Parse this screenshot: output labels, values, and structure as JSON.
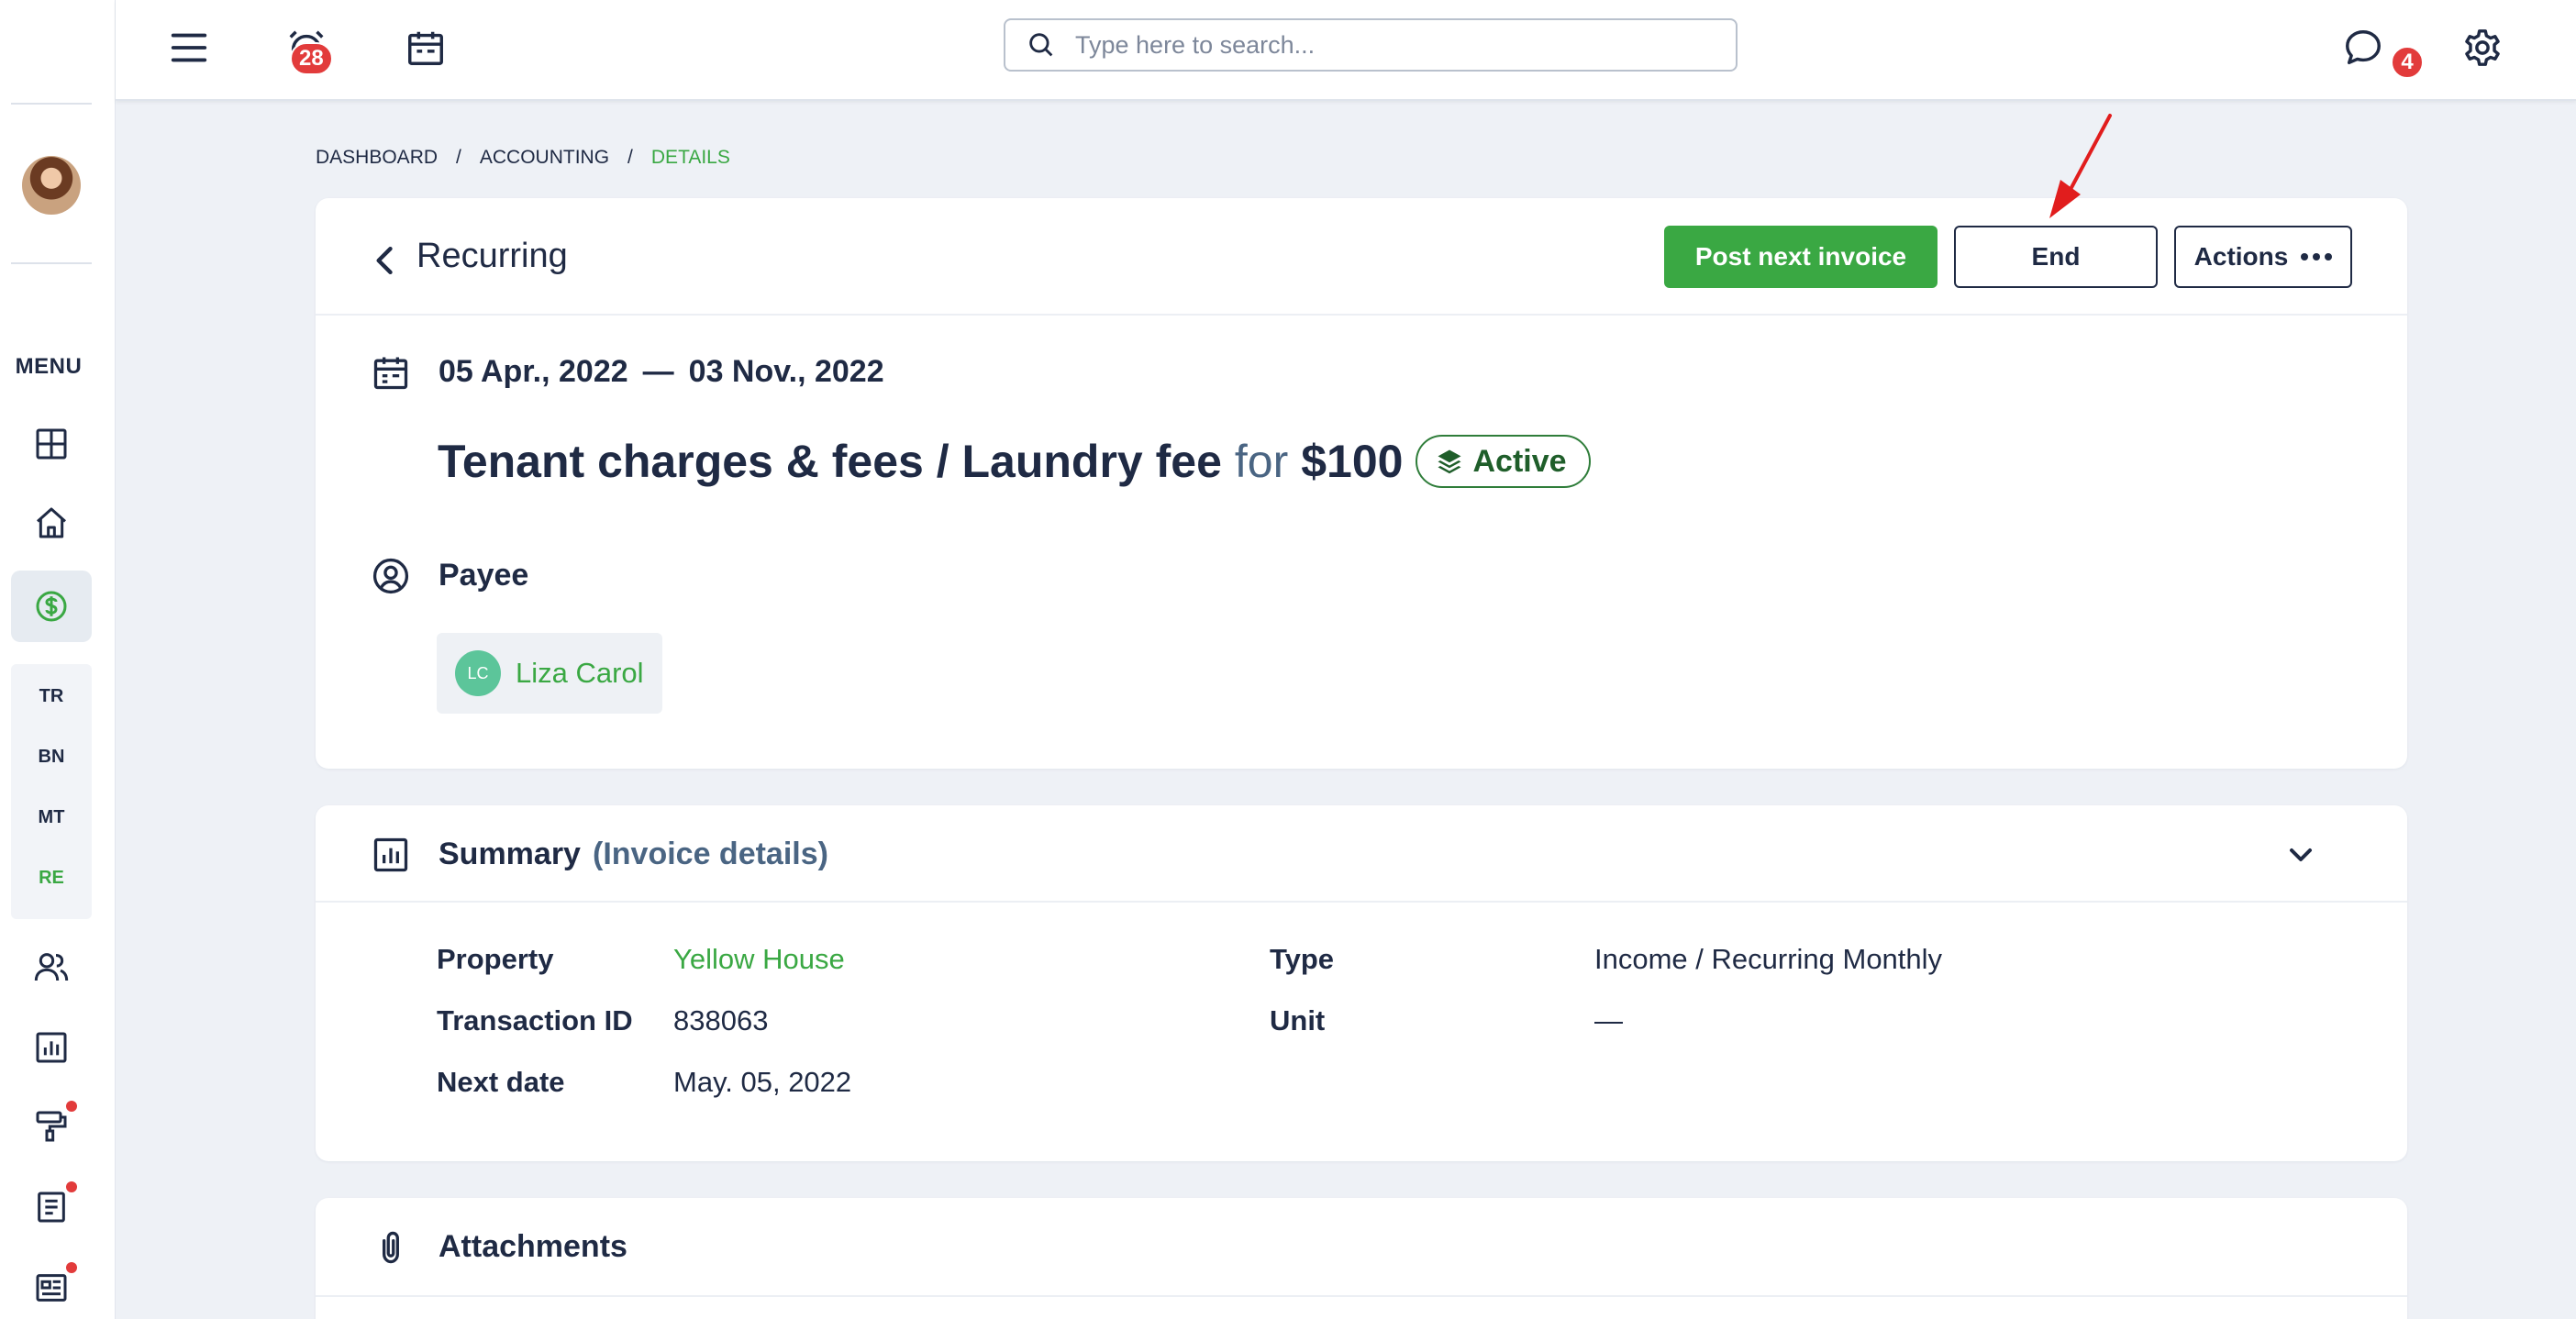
{
  "sidebar": {
    "menu_label": "MENU",
    "sub_items": [
      "TR",
      "BN",
      "MT",
      "RE"
    ],
    "active_sub": "RE"
  },
  "topbar": {
    "alarm_badge": "28",
    "chat_badge": "4",
    "search_placeholder": "Type here to search..."
  },
  "breadcrumb": {
    "items": [
      "DASHBOARD",
      "ACCOUNTING",
      "DETAILS"
    ],
    "separator": "/"
  },
  "header": {
    "title": "Recurring",
    "post_button": "Post next invoice",
    "end_button": "End",
    "actions_button": "Actions"
  },
  "recurring": {
    "start_date": "05 Apr., 2022",
    "date_separator": "—",
    "end_date": "03 Nov., 2022",
    "category": "Tenant charges & fees / Laundry fee",
    "for_word": "for",
    "amount": "$100",
    "status": "Active",
    "payee_label": "Payee",
    "payee": {
      "initials": "LC",
      "name": "Liza Carol"
    }
  },
  "summary": {
    "title": "Summary",
    "subtitle": "(Invoice details)",
    "fields_left": [
      {
        "label": "Property",
        "value": "Yellow House"
      },
      {
        "label": "Transaction ID",
        "value": "838063"
      },
      {
        "label": "Next date",
        "value": "May. 05, 2022"
      }
    ],
    "fields_right": [
      {
        "label": "Type",
        "value": "Income / Recurring Monthly"
      },
      {
        "label": "Unit",
        "value": "—"
      }
    ]
  },
  "attachments": {
    "title": "Attachments"
  },
  "colors": {
    "accent_green": "#3aa843",
    "navy": "#1f2a44",
    "badge_red": "#e23b3b",
    "page_bg": "#eef1f6"
  }
}
